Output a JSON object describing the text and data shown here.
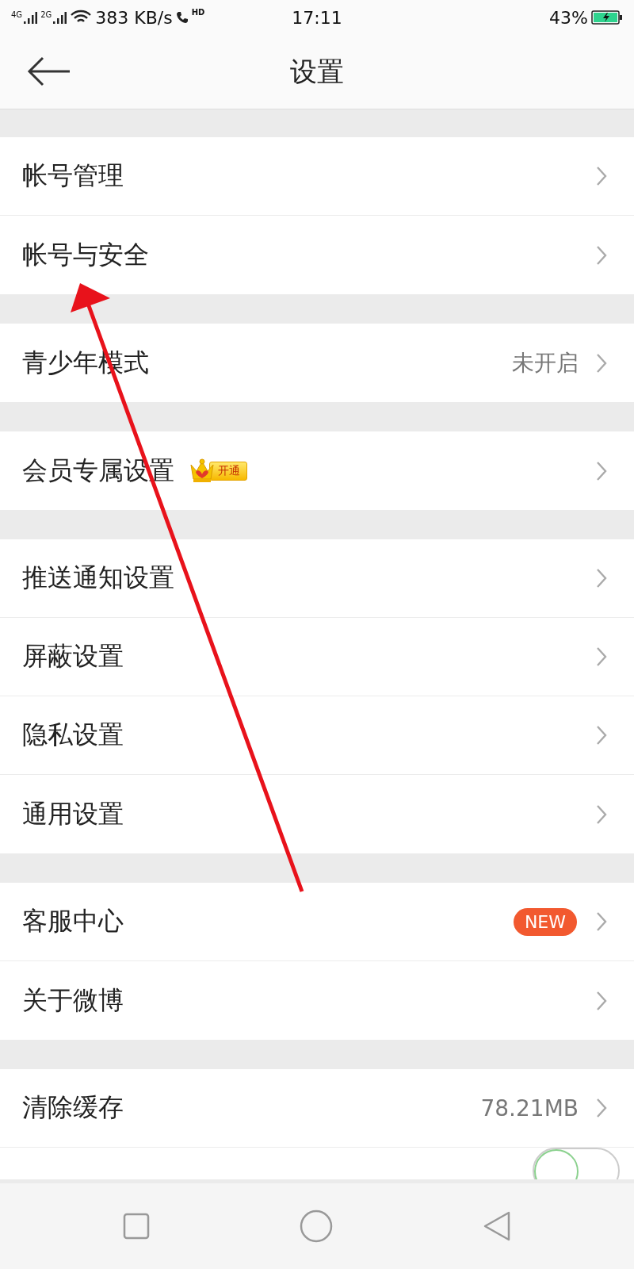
{
  "status_bar": {
    "signal_1": "4G",
    "signal_2": "2G",
    "speed": "383 KB/s",
    "call": "HD",
    "time": "17:11",
    "battery": "43%"
  },
  "header": {
    "title": "设置"
  },
  "groups": [
    {
      "items": [
        {
          "label": "帐号管理"
        },
        {
          "label": "帐号与安全"
        }
      ]
    },
    {
      "items": [
        {
          "label": "青少年模式",
          "value": "未开启"
        }
      ]
    },
    {
      "items": [
        {
          "label": "会员专属设置",
          "badge": {
            "kind": "vip",
            "text": "开通"
          }
        }
      ]
    },
    {
      "items": [
        {
          "label": "推送通知设置"
        },
        {
          "label": "屏蔽设置"
        },
        {
          "label": "隐私设置"
        },
        {
          "label": "通用设置"
        }
      ]
    },
    {
      "items": [
        {
          "label": "客服中心",
          "badge": {
            "kind": "new",
            "text": "NEW"
          }
        },
        {
          "label": "关于微博"
        }
      ]
    },
    {
      "items": [
        {
          "label": "清除缓存",
          "value": "78.21MB"
        },
        {
          "kind": "toggle",
          "on": false
        }
      ]
    }
  ],
  "annotation": {
    "kind": "arrow"
  }
}
